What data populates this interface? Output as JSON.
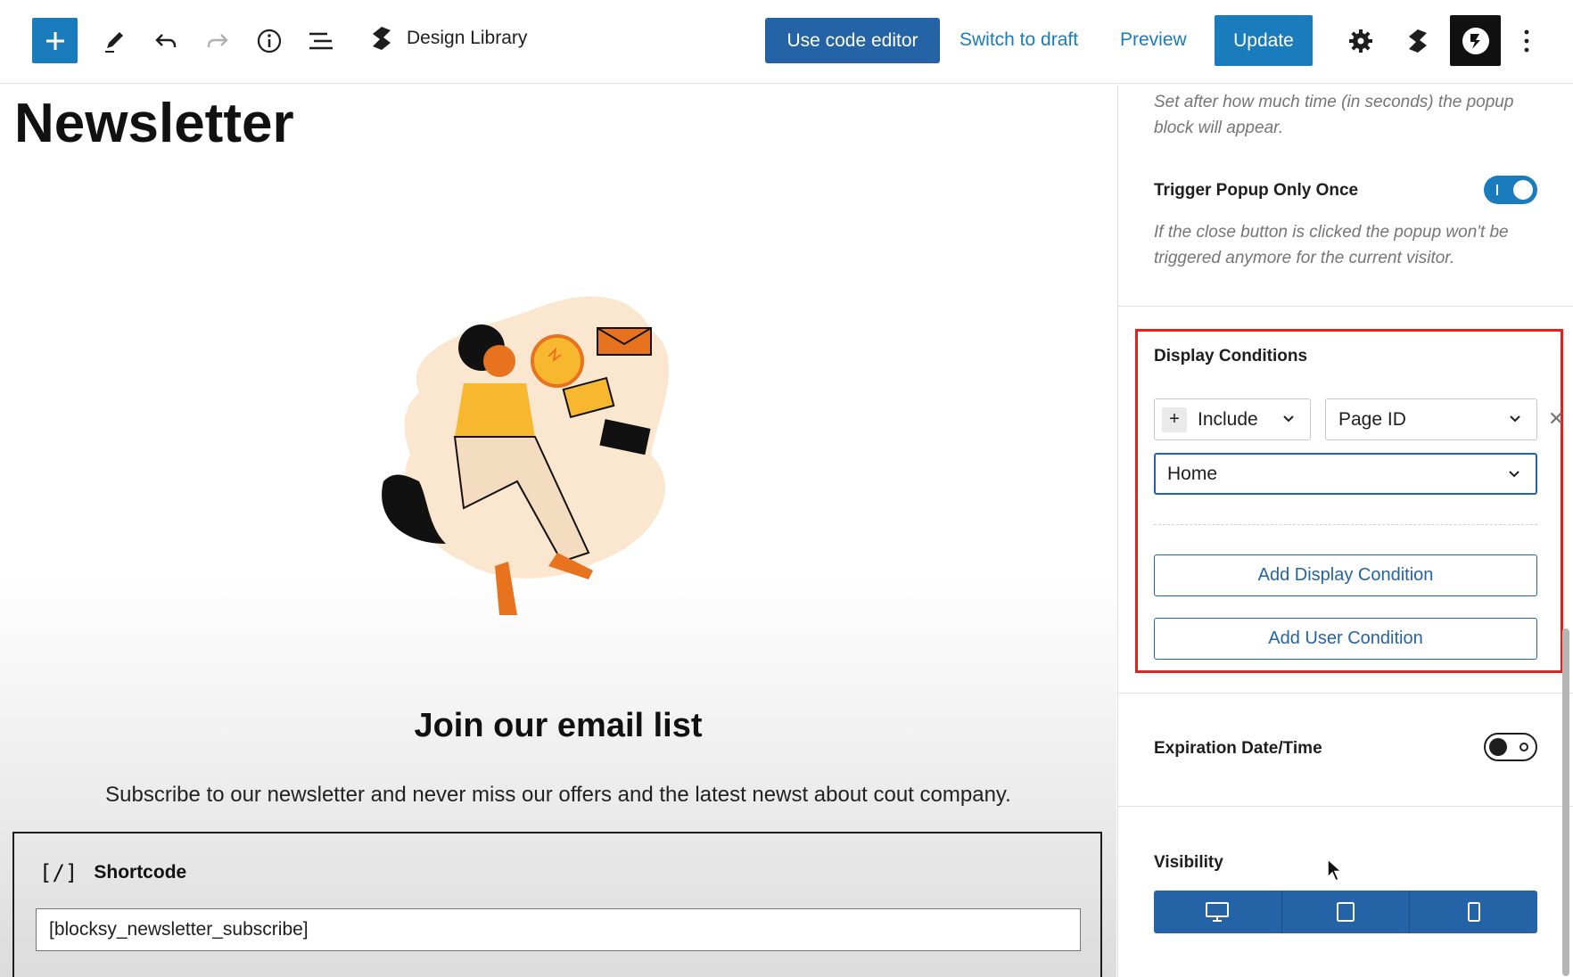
{
  "toolbar": {
    "brand_label": "Design Library",
    "use_code_editor_label": "Use code editor",
    "switch_to_draft_label": "Switch to draft",
    "preview_label": "Preview",
    "update_label": "Update"
  },
  "icons": [
    "add-block-icon",
    "pencil-icon",
    "undo-icon",
    "redo-icon",
    "info-icon",
    "list-view-icon",
    "stackable-logo-icon",
    "gear-icon",
    "blocksy-icon",
    "more-vertical-icon"
  ],
  "colors": {
    "primary": "#1a7bbd",
    "primary_dark": "#2463a6",
    "highlight": "#e8201c"
  },
  "canvas": {
    "post_title": "Newsletter",
    "join_title": "Join our email list",
    "subtext": "Subscribe to our newsletter and never miss our offers and the latest newst about cout company.",
    "shortcode": {
      "icon_text": "[/]",
      "label": "Shortcode",
      "value": "[blocksy_newsletter_subscribe]"
    }
  },
  "sidebar": {
    "delay_help": "Set after how much time (in seconds) the popup block will appear.",
    "trigger_once_label": "Trigger Popup Only Once",
    "trigger_once_on": true,
    "trigger_once_help": "If the close button is clicked the popup won't be triggered anymore for the current visitor.",
    "display_conditions": {
      "title": "Display Conditions",
      "rule_type": "Include",
      "rule_target": "Page ID",
      "rule_value": "Home",
      "remove_symbol": "✕",
      "add_display_label": "Add Display Condition",
      "add_user_label": "Add User Condition"
    },
    "expiration_label": "Expiration Date/Time",
    "expiration_on": false,
    "visibility_label": "Visibility"
  }
}
